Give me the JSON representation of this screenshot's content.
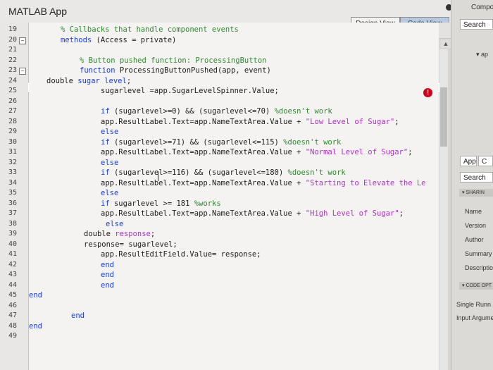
{
  "window": {
    "title": "MATLAB App"
  },
  "view_toggle": {
    "design_label": "Design View",
    "code_label": "Code View",
    "active": "code"
  },
  "line_numbers": [
    "19",
    "20",
    "21",
    "22",
    "23",
    "24",
    "25",
    "26",
    "27",
    "28",
    "29",
    "30",
    "31",
    "32",
    "33",
    "34",
    "35",
    "36",
    "37",
    "38",
    "39",
    "40",
    "41",
    "42",
    "43",
    "44",
    "45",
    "46",
    "47",
    "48",
    "49"
  ],
  "code_lines": [
    [
      [
        "cm",
        "% Callbacks that handle component events"
      ]
    ],
    [
      [
        "kw",
        "methods"
      ],
      [
        "",
        "(Access = private)"
      ]
    ],
    [],
    [
      [
        "cm",
        "% Button pushed function: ProcessingButton"
      ]
    ],
    [
      [
        "kw",
        "function"
      ],
      [
        "",
        "ProcessingButtonPushed(app, event)"
      ]
    ],
    [
      [
        "",
        "double "
      ],
      [
        "kw",
        "sugar level"
      ],
      [
        "",
        ";"
      ]
    ],
    [
      [
        "",
        "sugarlevel =app.SugarLevelSpinner.Value;"
      ]
    ],
    [],
    [
      [
        "kw",
        "if"
      ],
      [
        "",
        "(sugarlevel>=0) && (sugarlevel<=70) "
      ],
      [
        "cm",
        "%doesn't work"
      ]
    ],
    [
      [
        "",
        "app.ResultLabel.Text=app.NameTextArea.Value + "
      ],
      [
        "st",
        "\"Low Level of Sugar\""
      ],
      [
        "",
        ";"
      ]
    ],
    [
      [
        "kw",
        "else"
      ]
    ],
    [
      [
        "kw",
        "if"
      ],
      [
        "",
        "(sugarlevel>=71) && (sugarlevel<=115) "
      ],
      [
        "cm",
        "%doesn't work"
      ]
    ],
    [
      [
        "",
        "app.ResultLabel.Text=app.NameTextArea.Value + "
      ],
      [
        "st",
        "\"Normal Level of Sugar\""
      ],
      [
        "",
        ";"
      ]
    ],
    [
      [
        "kw",
        "else"
      ]
    ],
    [
      [
        "kw",
        "if"
      ],
      [
        "",
        "(sugarlevel>=116) && (sugarlevel<=180) "
      ],
      [
        "cm",
        "%doesn't work"
      ]
    ],
    [
      [
        "",
        "app.ResultLabel.Text=app.NameTextArea.Value + "
      ],
      [
        "st",
        "\"Starting to Elevate the Le"
      ]
    ],
    [
      [
        "kw",
        "else"
      ]
    ],
    [
      [
        "kw",
        "if"
      ],
      [
        "",
        "sugarlevel >= 181 "
      ],
      [
        "cm",
        "%works"
      ]
    ],
    [
      [
        "",
        "app.ResultLabel.Text=app.NameTextArea.Value + "
      ],
      [
        "st",
        "\"High Level of Sugar\""
      ],
      [
        "",
        ";"
      ]
    ],
    [
      [
        "kw",
        "else"
      ]
    ],
    [
      [
        "",
        "double "
      ],
      [
        "st",
        "response"
      ],
      [
        "",
        ";"
      ]
    ],
    [
      [
        "",
        "response= sugarlevel;"
      ]
    ],
    [
      [
        "",
        "app.ResultEditField.Value= response;"
      ]
    ],
    [
      [
        "kw",
        "end"
      ]
    ],
    [
      [
        "kw",
        "end"
      ]
    ],
    [
      [
        "kw",
        "end"
      ]
    ],
    [
      [
        "kw",
        "end"
      ]
    ],
    [],
    [
      [
        "kw",
        "end"
      ]
    ],
    [
      [
        "kw",
        "end"
      ]
    ],
    []
  ],
  "right_panel": {
    "comp_label": "Compo",
    "search_top": "Search",
    "ap_label": "▾ ap",
    "app_tab": "App",
    "app_tab2": "C",
    "search_mid": "Search",
    "sharing_header": "▾ SHARIN",
    "fields": [
      "Name",
      "Version",
      "Author",
      "Summary",
      "Description"
    ],
    "code_options_header": "▾ CODE OPT",
    "single_running": "Single Runn",
    "input_arguments": "Input Argumen"
  }
}
